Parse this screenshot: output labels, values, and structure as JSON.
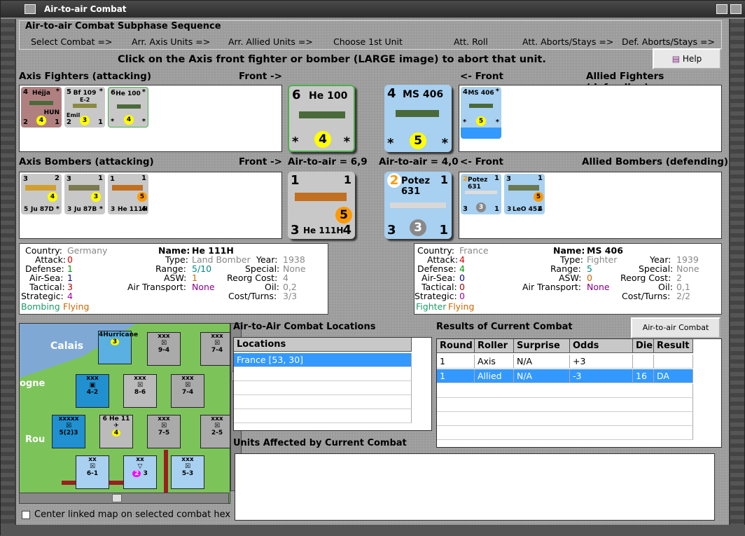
{
  "window": {
    "title": "Air-to-air Combat"
  },
  "sequence": {
    "title": "Air-to-air Combat Subphase Sequence",
    "steps": [
      "Select Combat =>",
      "Arr. Axis Units =>",
      "Arr. Allied Units =>",
      "Choose 1st Unit",
      "Att. Roll",
      "Att. Aborts/Stays =>",
      "Def. Aborts/Stays =>"
    ]
  },
  "instruction": "Click on the Axis front fighter or bomber  (LARGE image) to abort that unit.",
  "help_label": "Help",
  "labels": {
    "axis_fighters": "Axis Fighters (attacking)",
    "front_right": "Front ->",
    "front_left": "<- Front",
    "allied_fighters": "Allied Fighters (defending)",
    "axis_bombers": "Axis Bombers (attacking)",
    "air_axis": "Air-to-air = 6,9",
    "air_allied": "Air-to-air = 4,0",
    "allied_bombers": "Allied Bombers (defending)"
  },
  "axis_fighters": [
    {
      "name": "Héjja",
      "tl": "4",
      "tr": "*",
      "bl": "2",
      "br": "1",
      "circle": "4",
      "sub": "HUN",
      "bg": "#b08080"
    },
    {
      "name": "Bf 109",
      "tl": "5",
      "tr": "*",
      "bl": "2",
      "br": "1",
      "circle": "3",
      "sub": "Emil",
      "extra": "E-2",
      "bg": "#c8c8c8"
    },
    {
      "name": "He 100",
      "tl": "6",
      "tr": "*",
      "bl": "*",
      "br": "*",
      "circle": "4",
      "sub": "",
      "bg": "#c8c8c8"
    }
  ],
  "axis_front_fighter": {
    "name": "He 100",
    "tl": "6",
    "tr": "",
    "bl": "*",
    "br": "*",
    "circle": "4"
  },
  "allied_front_fighter": {
    "name": "MS 406",
    "tl": "4",
    "tr": "",
    "bl": "*",
    "br": "*",
    "circle": "5"
  },
  "allied_fighters": [
    {
      "name": "MS 406",
      "tl": "4",
      "tr": "*",
      "bl": "*",
      "br": "*",
      "circle": "5"
    }
  ],
  "axis_bombers": [
    {
      "name": "Ju 87D",
      "tl": "3",
      "tr": "2",
      "bl": "5",
      "br": "*",
      "circle": "4",
      "bg": "#c8c8c8"
    },
    {
      "name": "Ju 87B",
      "tl": "3",
      "tr": "1",
      "bl": "3",
      "br": "*",
      "circle": "3",
      "bg": "#c8c8c8"
    },
    {
      "name": "He 111H",
      "tl": "1",
      "tr": "1",
      "bl": "3",
      "br": "4",
      "circle": "5",
      "bg": "#c8c8c8"
    }
  ],
  "axis_front_bomber": {
    "name": "He 111H",
    "tl": "1",
    "tr": "1",
    "bl": "3",
    "br": "4",
    "circle": "5"
  },
  "allied_front_bomber": {
    "name": "Potez 631",
    "tl": "2",
    "tr": "1",
    "bl": "3",
    "br": "1",
    "circle": "3"
  },
  "allied_bombers": [
    {
      "name": "Potez 631",
      "tl": "2",
      "tr": "1",
      "bl": "3",
      "br": "1",
      "circle": "3"
    },
    {
      "name": "LeO 451",
      "tl": "3",
      "tr": "1",
      "bl": "3",
      "br": "4",
      "circle": "5"
    }
  ],
  "axis_info": {
    "country_l": "Country:",
    "country": "Germany",
    "attack_l": "Attack:",
    "attack": "0",
    "defense_l": "Defense:",
    "defense": "1",
    "airsea_l": "Air-Sea:",
    "airsea": "1",
    "tactical_l": "Tactical:",
    "tactical": "3",
    "strategic_l": "Strategic:",
    "strategic": "4",
    "role1": "Bombing",
    "role2": "Flying",
    "name_l": "Name:",
    "name": "He 111H",
    "type_l": "Type:",
    "type": "Land Bomber",
    "range_l": "Range:",
    "range": "5/10",
    "asw_l": "ASW:",
    "asw": "1",
    "airtrans_l": "Air Transport:",
    "airtrans": "None",
    "year_l": "Year:",
    "year": "1938",
    "special_l": "Special:",
    "special": "None",
    "reorg_l": "Reorg Cost:",
    "reorg": "4",
    "oil_l": "Oil:",
    "oil": "0,2",
    "cost_l": "Cost/Turns:",
    "cost": "3/3"
  },
  "allied_info": {
    "country_l": "Country:",
    "country": "France",
    "attack_l": "Attack:",
    "attack": "4",
    "defense_l": "Defense:",
    "defense": "4",
    "airsea_l": "Air-Sea:",
    "airsea": "0",
    "tactical_l": "Tactical:",
    "tactical": "0",
    "strategic_l": "Strategic:",
    "strategic": "0",
    "role1": "Fighter",
    "role2": "Flying",
    "name_l": "Name:",
    "name": "MS 406",
    "type_l": "Type:",
    "type": "Fighter",
    "range_l": "Range:",
    "range": "5",
    "asw_l": "ASW:",
    "asw": "0",
    "airtrans_l": "Air Transport:",
    "airtrans": "None",
    "year_l": "Year:",
    "year": "1939",
    "special_l": "Special:",
    "special": "None",
    "reorg_l": "Reorg Cost:",
    "reorg": "2",
    "oil_l": "Oil:",
    "oil": "0,1",
    "cost_l": "Cost/Turns:",
    "cost": "2/2"
  },
  "map": {
    "places": [
      "Calais",
      "ogne",
      "Rou"
    ],
    "units": [
      {
        "label": "Hurricane",
        "val": "3",
        "tl": "4"
      },
      {
        "label": "9-4",
        "val": "",
        "tl": "xxx"
      },
      {
        "label": "7-4",
        "val": "",
        "tl": "xxx"
      },
      {
        "label": "4-2",
        "val": "",
        "tl": "xxx"
      },
      {
        "label": "8-6",
        "val": "",
        "tl": "xxx"
      },
      {
        "label": "7-4",
        "val": "",
        "tl": "xxx"
      },
      {
        "label": "5(2)3",
        "val": "",
        "tl": "xxxxx"
      },
      {
        "label": "He 11",
        "val": "4",
        "tl": "6"
      },
      {
        "label": "7-5",
        "val": "",
        "tl": "xxx"
      },
      {
        "label": "2-5",
        "val": "",
        "tl": "xxx"
      },
      {
        "label": "6-1",
        "val": "",
        "tl": "xx"
      },
      {
        "label": "3",
        "val": "2",
        "tl": "xx"
      },
      {
        "label": "5-3",
        "val": "",
        "tl": "xxx"
      }
    ]
  },
  "locations": {
    "title": "Air-to-Air Combat Locations",
    "header": "Locations",
    "rows": [
      "France [53, 30]"
    ]
  },
  "results": {
    "title": "Results of Current Combat",
    "headers": [
      "Round",
      "Roller",
      "Surprise",
      "Odds",
      "Die",
      "Result"
    ],
    "rows": [
      [
        "1",
        "Axis",
        "N/A",
        "+3",
        "",
        ""
      ],
      [
        "1",
        "Allied",
        "N/A",
        "-3",
        "16",
        "DA"
      ]
    ]
  },
  "chart_button": "Air-to-air Combat Chart",
  "affected_title": "Units Affected by Current Combat",
  "center_map": "Center linked map on selected combat hex",
  "colors": {
    "yellow": "#ffff00",
    "orange": "#ff9900",
    "allied_blue": "#a8d0f0",
    "green_border": "#4ab04a"
  }
}
